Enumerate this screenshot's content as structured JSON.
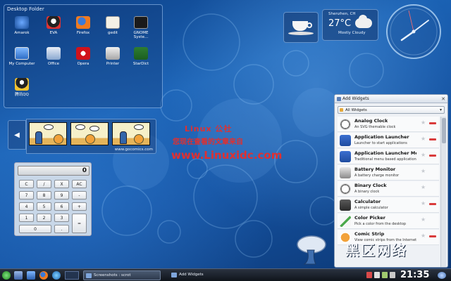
{
  "folder": {
    "title": "Desktop Folder",
    "icons": [
      {
        "label": "Amarok",
        "icon": "amarok-icon"
      },
      {
        "label": "EVA",
        "icon": "eva-icon"
      },
      {
        "label": "Firefox",
        "icon": "firefox-icon"
      },
      {
        "label": "gedit",
        "icon": "gedit-icon"
      },
      {
        "label": "GNOME Syste...",
        "icon": "gnome-system-monitor-icon"
      },
      {
        "label": "My Computer",
        "icon": "my-computer-icon"
      },
      {
        "label": "Office",
        "icon": "office-icon"
      },
      {
        "label": "Opera",
        "icon": "opera-icon"
      },
      {
        "label": "Printer",
        "icon": "printer-icon"
      },
      {
        "label": "StarDict",
        "icon": "stardict-icon"
      },
      {
        "label": "腾讯QQ",
        "icon": "qq-icon"
      }
    ]
  },
  "comic": {
    "url": "www.gocomics.com",
    "prev_glyph": "◀"
  },
  "calculator": {
    "display": "0",
    "keys": [
      "C",
      "/",
      "X",
      "AC",
      "7",
      "8",
      "9",
      "-",
      "4",
      "5",
      "6",
      "+",
      "1",
      "2",
      "3",
      "=",
      "0",
      "."
    ]
  },
  "watermark": {
    "line1": "Linux 公社",
    "line2": "您现在查看的文章来自",
    "line3": "www.Linuxidc.com"
  },
  "weather": {
    "city": "Shenzhen, CH",
    "temp": "27°C",
    "condition": "Mostly Cloudy"
  },
  "add_widgets": {
    "title": "Add Widgets",
    "close_glyph": "✕",
    "filter": "All Widgets",
    "filter_arrow": "▾",
    "items": [
      {
        "name": "Analog Clock",
        "desc": "An SVG themable clock",
        "installed": true
      },
      {
        "name": "Application Launcher",
        "desc": "Launcher to start applications",
        "installed": true
      },
      {
        "name": "Application Launcher Menu",
        "desc": "Traditional menu based application launcher",
        "installed": true
      },
      {
        "name": "Battery Monitor",
        "desc": "A battery charge monitor",
        "installed": false
      },
      {
        "name": "Binary Clock",
        "desc": "A binary clock",
        "installed": false
      },
      {
        "name": "Calculator",
        "desc": "A simple calculator",
        "installed": true
      },
      {
        "name": "Color Picker",
        "desc": "Pick a color from the desktop",
        "installed": false
      },
      {
        "name": "Comic Strip",
        "desc": "View comic strips from the Internet",
        "installed": true
      }
    ],
    "star_glyph": "★"
  },
  "taskbar": {
    "tasks": [
      {
        "label": "Screenshots : scrot"
      },
      {
        "label": "Add Widgets"
      }
    ],
    "time": "21:35"
  },
  "logo": {
    "text": "黑区网络"
  }
}
